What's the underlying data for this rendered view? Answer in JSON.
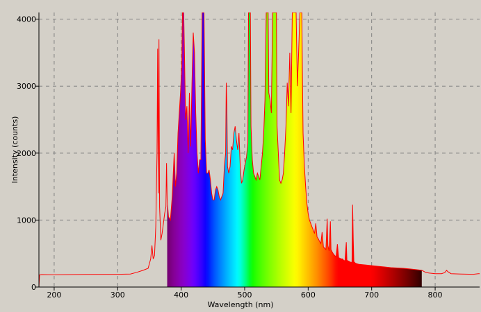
{
  "chart_data": {
    "type": "line",
    "title": "",
    "xlabel": "Wavelength (nm)",
    "ylabel": "Intensity (counts)",
    "xlim": [
      176,
      870
    ],
    "ylim": [
      0,
      4100
    ],
    "xticks": [
      200,
      300,
      400,
      500,
      600,
      700,
      800
    ],
    "yticks": [
      0,
      1000,
      2000,
      3000,
      4000
    ],
    "grid": true,
    "legend": "none",
    "colors": {
      "background": "#d4d0c8",
      "line": "#ff0000",
      "grid": "#808080"
    },
    "colored_fill_range": [
      378,
      779
    ],
    "series": [
      {
        "name": "",
        "points": [
          [
            176,
            0
          ],
          [
            177,
            180
          ],
          [
            180,
            185
          ],
          [
            200,
            182
          ],
          [
            250,
            188
          ],
          [
            300,
            190
          ],
          [
            320,
            195
          ],
          [
            330,
            220
          ],
          [
            340,
            250
          ],
          [
            348,
            280
          ],
          [
            352,
            420
          ],
          [
            354,
            620
          ],
          [
            356,
            420
          ],
          [
            358,
            470
          ],
          [
            360,
            900
          ],
          [
            362,
            2000
          ],
          [
            363,
            3560
          ],
          [
            364,
            1400
          ],
          [
            365,
            3700
          ],
          [
            366,
            1200
          ],
          [
            368,
            700
          ],
          [
            370,
            800
          ],
          [
            372,
            950
          ],
          [
            374,
            1100
          ],
          [
            376,
            1200
          ],
          [
            377,
            1850
          ],
          [
            378,
            1300
          ],
          [
            380,
            1050
          ],
          [
            383,
            1000
          ],
          [
            386,
            1350
          ],
          [
            389,
            2000
          ],
          [
            391,
            1500
          ],
          [
            393,
            1700
          ],
          [
            395,
            2300
          ],
          [
            397,
            2600
          ],
          [
            399,
            2900
          ],
          [
            401,
            3300
          ],
          [
            402,
            4100
          ],
          [
            404,
            4100
          ],
          [
            405,
            3600
          ],
          [
            407,
            2500
          ],
          [
            409,
            2700
          ],
          [
            411,
            2000
          ],
          [
            413,
            2900
          ],
          [
            415,
            2100
          ],
          [
            417,
            3050
          ],
          [
            419,
            3800
          ],
          [
            421,
            3500
          ],
          [
            423,
            2600
          ],
          [
            425,
            2000
          ],
          [
            427,
            1700
          ],
          [
            429,
            1900
          ],
          [
            431,
            1900
          ],
          [
            433,
            4100
          ],
          [
            436,
            4100
          ],
          [
            438,
            2200
          ],
          [
            440,
            1700
          ],
          [
            442,
            1700
          ],
          [
            444,
            1750
          ],
          [
            446,
            1600
          ],
          [
            448,
            1400
          ],
          [
            450,
            1300
          ],
          [
            452,
            1300
          ],
          [
            454,
            1450
          ],
          [
            456,
            1500
          ],
          [
            458,
            1450
          ],
          [
            460,
            1350
          ],
          [
            462,
            1300
          ],
          [
            464,
            1350
          ],
          [
            466,
            1400
          ],
          [
            468,
            1800
          ],
          [
            470,
            2000
          ],
          [
            471,
            3050
          ],
          [
            472,
            2700
          ],
          [
            473,
            1800
          ],
          [
            475,
            1700
          ],
          [
            477,
            1800
          ],
          [
            479,
            2100
          ],
          [
            481,
            2050
          ],
          [
            483,
            2300
          ],
          [
            485,
            2400
          ],
          [
            487,
            2200
          ],
          [
            489,
            2050
          ],
          [
            491,
            2300
          ],
          [
            493,
            1800
          ],
          [
            495,
            1550
          ],
          [
            497,
            1600
          ],
          [
            499,
            1750
          ],
          [
            501,
            1850
          ],
          [
            503,
            1950
          ],
          [
            505,
            2150
          ],
          [
            506,
            4100
          ],
          [
            509,
            4100
          ],
          [
            510,
            2400
          ],
          [
            512,
            1900
          ],
          [
            514,
            1700
          ],
          [
            516,
            1650
          ],
          [
            518,
            1600
          ],
          [
            520,
            1700
          ],
          [
            522,
            1650
          ],
          [
            524,
            1600
          ],
          [
            526,
            1800
          ],
          [
            528,
            2000
          ],
          [
            530,
            2300
          ],
          [
            532,
            2800
          ],
          [
            534,
            4100
          ],
          [
            537,
            4100
          ],
          [
            538,
            2900
          ],
          [
            540,
            2800
          ],
          [
            542,
            2600
          ],
          [
            544,
            4100
          ],
          [
            550,
            4100
          ],
          [
            551,
            2400
          ],
          [
            553,
            2000
          ],
          [
            555,
            1600
          ],
          [
            557,
            1550
          ],
          [
            559,
            1600
          ],
          [
            561,
            1700
          ],
          [
            563,
            2000
          ],
          [
            565,
            2400
          ],
          [
            567,
            3050
          ],
          [
            569,
            2700
          ],
          [
            571,
            3500
          ],
          [
            573,
            2600
          ],
          [
            575,
            4100
          ],
          [
            581,
            4100
          ],
          [
            583,
            3000
          ],
          [
            585,
            3500
          ],
          [
            587,
            4100
          ],
          [
            590,
            4100
          ],
          [
            592,
            2300
          ],
          [
            594,
            1800
          ],
          [
            596,
            1500
          ],
          [
            598,
            1250
          ],
          [
            600,
            1100
          ],
          [
            602,
            1000
          ],
          [
            604,
            950
          ],
          [
            606,
            900
          ],
          [
            608,
            850
          ],
          [
            610,
            800
          ],
          [
            612,
            950
          ],
          [
            614,
            750
          ],
          [
            616,
            720
          ],
          [
            618,
            680
          ],
          [
            620,
            650
          ],
          [
            622,
            820
          ],
          [
            624,
            600
          ],
          [
            626,
            580
          ],
          [
            628,
            560
          ],
          [
            630,
            1020
          ],
          [
            631,
            620
          ],
          [
            633,
            540
          ],
          [
            635,
            980
          ],
          [
            636,
            560
          ],
          [
            638,
            520
          ],
          [
            640,
            490
          ],
          [
            642,
            470
          ],
          [
            644,
            450
          ],
          [
            646,
            640
          ],
          [
            648,
            440
          ],
          [
            650,
            430
          ],
          [
            652,
            420
          ],
          [
            654,
            420
          ],
          [
            656,
            400
          ],
          [
            658,
            390
          ],
          [
            660,
            670
          ],
          [
            661,
            400
          ],
          [
            663,
            390
          ],
          [
            665,
            380
          ],
          [
            667,
            370
          ],
          [
            669,
            370
          ],
          [
            670,
            1230
          ],
          [
            671,
            720
          ],
          [
            672,
            380
          ],
          [
            674,
            360
          ],
          [
            676,
            350
          ],
          [
            680,
            340
          ],
          [
            690,
            330
          ],
          [
            700,
            320
          ],
          [
            710,
            310
          ],
          [
            720,
            300
          ],
          [
            730,
            290
          ],
          [
            740,
            285
          ],
          [
            750,
            280
          ],
          [
            760,
            270
          ],
          [
            770,
            260
          ],
          [
            779,
            250
          ],
          [
            785,
            220
          ],
          [
            790,
            210
          ],
          [
            800,
            200
          ],
          [
            810,
            200
          ],
          [
            815,
            215
          ],
          [
            818,
            250
          ],
          [
            820,
            230
          ],
          [
            825,
            200
          ],
          [
            840,
            195
          ],
          [
            860,
            190
          ],
          [
            868,
            200
          ],
          [
            870,
            200
          ]
        ]
      }
    ]
  }
}
